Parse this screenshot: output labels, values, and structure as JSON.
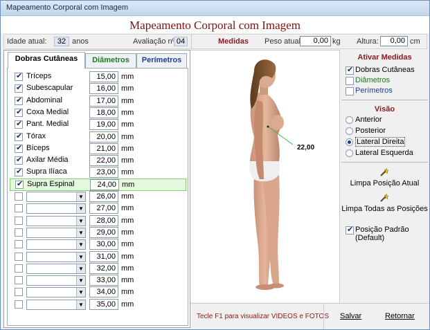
{
  "window": {
    "title": "Mapeamento Corporal com Imagem"
  },
  "header": {
    "title": "Mapeamento Corporal com Imagem"
  },
  "info": {
    "age_label": "Idade atual:",
    "age_value": "32",
    "age_unit": "anos",
    "eval_label": "Avaliação nº:",
    "eval_value": "04",
    "measures_title": "Medidas",
    "weight_label": "Peso atual:",
    "weight_value": "0,00",
    "weight_unit": "kg",
    "height_label": "Altura:",
    "height_value": "0,00",
    "height_unit": "cm"
  },
  "tabs": [
    {
      "label": "Dobras Cutâneas",
      "color": "#000000"
    },
    {
      "label": "Diâmetros",
      "color": "#1e7a1e"
    },
    {
      "label": "Perímetros",
      "color": "#1d3f8f"
    }
  ],
  "rows": [
    {
      "checked": true,
      "label": "Tríceps",
      "value": "15,00",
      "unit": "mm"
    },
    {
      "checked": true,
      "label": "Subescapular",
      "value": "16,00",
      "unit": "mm"
    },
    {
      "checked": true,
      "label": "Abdominal",
      "value": "17,00",
      "unit": "mm"
    },
    {
      "checked": true,
      "label": "Coxa Medial",
      "value": "18,00",
      "unit": "mm"
    },
    {
      "checked": true,
      "label": "Pant. Medial",
      "value": "19,00",
      "unit": "mm"
    },
    {
      "checked": true,
      "label": "Tórax",
      "value": "20,00",
      "unit": "mm"
    },
    {
      "checked": true,
      "label": "Bíceps",
      "value": "21,00",
      "unit": "mm"
    },
    {
      "checked": true,
      "label": "Axilar Média",
      "value": "22,00",
      "unit": "mm"
    },
    {
      "checked": true,
      "label": "Supra Ilíaca",
      "value": "23,00",
      "unit": "mm"
    },
    {
      "checked": true,
      "label": "Supra Espinal",
      "value": "24,00",
      "unit": "mm",
      "highlight": true
    },
    {
      "checked": false,
      "label": "",
      "value": "26,00",
      "unit": "mm"
    },
    {
      "checked": false,
      "label": "",
      "value": "27,00",
      "unit": "mm"
    },
    {
      "checked": false,
      "label": "",
      "value": "28,00",
      "unit": "mm"
    },
    {
      "checked": false,
      "label": "",
      "value": "29,00",
      "unit": "mm"
    },
    {
      "checked": false,
      "label": "",
      "value": "30,00",
      "unit": "mm"
    },
    {
      "checked": false,
      "label": "",
      "value": "31,00",
      "unit": "mm"
    },
    {
      "checked": false,
      "label": "",
      "value": "32,00",
      "unit": "mm"
    },
    {
      "checked": false,
      "label": "",
      "value": "33,00",
      "unit": "mm"
    },
    {
      "checked": false,
      "label": "",
      "value": "34,00",
      "unit": "mm"
    },
    {
      "checked": false,
      "label": "",
      "value": "35,00",
      "unit": "mm"
    }
  ],
  "figure": {
    "measure_label": "22,00"
  },
  "activate": {
    "title": "Ativar Medidas",
    "items": [
      {
        "label": "Dobras Cutâneas",
        "checked": true,
        "color": "#000000"
      },
      {
        "label": "Diâmetros",
        "checked": false,
        "color": "#1e7a1e"
      },
      {
        "label": "Perímetros",
        "checked": false,
        "color": "#1d3f8f"
      }
    ]
  },
  "view": {
    "title": "Visão",
    "options": [
      {
        "label": "Anterior",
        "selected": false
      },
      {
        "label": "Posterior",
        "selected": false
      },
      {
        "label": "Lateral Direita",
        "selected": true
      },
      {
        "label": "Lateral Esquerda",
        "selected": false
      }
    ]
  },
  "actions": {
    "clear_current": "Limpa Posição Atual",
    "clear_all": "Limpa Todas as Posições",
    "default_pos": "Posição Padrão (Default)",
    "default_checked": true
  },
  "footer": {
    "hint": "Tecle F1 para visualizar VIDEOS e FOTOS",
    "save": "Salvar",
    "back": "Retornar"
  },
  "colors": {
    "title_red": "#7a1212",
    "hint_red": "#8b1a1a",
    "highlight_green": "#7fd06a"
  }
}
